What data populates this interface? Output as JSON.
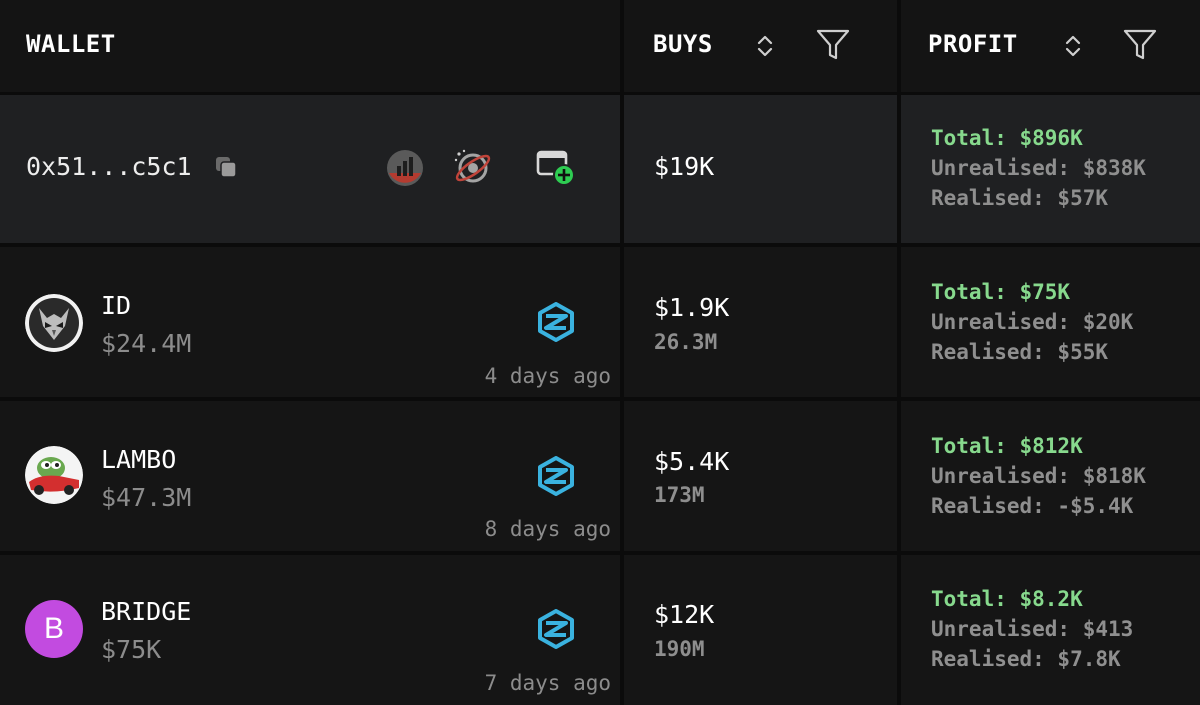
{
  "header": {
    "wallet_label": "WALLET",
    "buys_label": "BUYS",
    "profit_label": "PROFIT",
    "sort_icon": "sort-updown-icon",
    "filter_icon": "filter-funnel-icon"
  },
  "wallet": {
    "address": "0x51...c5c1",
    "buys": "$19K",
    "profit": {
      "total": "Total: $896K",
      "unrealised": "Unrealised: $838K",
      "realised": "Realised: $57K"
    },
    "icons": [
      "copy-icon",
      "chart-logo-icon",
      "planet-icon",
      "add-wallet-icon"
    ]
  },
  "rows": [
    {
      "name": "ID",
      "mcap": "$24.4M",
      "ago": "4 days ago",
      "buy_usd": "$1.9K",
      "buy_amount": "26.3M",
      "total": "Total: $75K",
      "unrealised": "Unrealised: $20K",
      "realised": "Realised: $55K",
      "avatar_icon": "owl-avatar-icon"
    },
    {
      "name": "LAMBO",
      "mcap": "$47.3M",
      "ago": "8 days ago",
      "buy_usd": "$5.4K",
      "buy_amount": "173M",
      "total": "Total: $812K",
      "unrealised": "Unrealised: $818K",
      "realised": "Realised: -$5.4K",
      "avatar_icon": "pepe-car-avatar-icon"
    },
    {
      "name": "BRIDGE",
      "mcap": "$75K",
      "ago": "7 days ago",
      "buy_usd": "$12K",
      "buy_amount": "190M",
      "total": "Total: $8.2K",
      "unrealised": "Unrealised: $413",
      "realised": "Realised: $7.8K",
      "avatar_letter": "B",
      "avatar_color": "#c24be0"
    }
  ],
  "colors": {
    "background": "#151515",
    "wallet_row": "#1f2022",
    "profit_total": "#87d98d",
    "muted": "#8c8c8c",
    "dex_blue": "#3ab2df"
  }
}
